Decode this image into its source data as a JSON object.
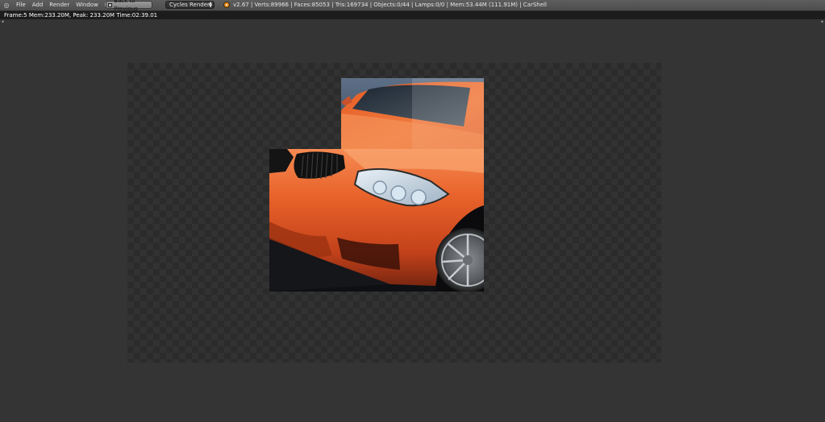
{
  "header": {
    "editor_type_icon": "image-editor-icon",
    "menu": [
      "File",
      "Add",
      "Render",
      "Window",
      "Help"
    ],
    "back_button": "Back to Previous",
    "render_engine": "Cycles Render",
    "logo_icon": "blender-logo-icon",
    "stats": "v2.67 | Verts:89966 | Faces:85053 | Tris:169734 | Objects:0/44 | Lamps:0/0 | Mem:53.44M (111.91M) | CarShell"
  },
  "render_info": {
    "text": "Frame:5 Mem:233.20M, Peak: 233.20M Time:02:39.01"
  },
  "render": {
    "subject": "orange-sports-car-front-render",
    "colors": {
      "background": "#343434",
      "car_paint": "#e8622a",
      "headlight": "#cfe0ee",
      "grille": "#111111"
    }
  }
}
